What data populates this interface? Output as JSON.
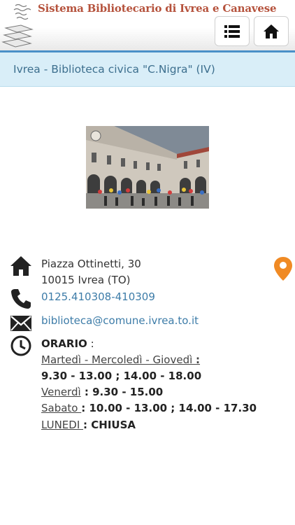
{
  "header": {
    "site_title": "Sistema Bibliotecario di Ivrea e Canavese",
    "menu_icon": "list-icon",
    "home_icon": "home-icon",
    "brand_color": "#b5523c",
    "accent_color": "#4a90c8"
  },
  "breadcrumb": {
    "title": "Ivrea - Biblioteca civica \"C.Nigra\" (IV)"
  },
  "library": {
    "address_line1": "Piazza Ottinetti, 30",
    "address_line2": "10015 Ivrea (TO)",
    "phone": "0125.410308-410309",
    "email": "biblioteca@comune.ivrea.to.it",
    "hours_label": "ORARIO",
    "hours_colon": " :",
    "schedule": [
      {
        "day": "Martedì - Mercoledì - Giovedì ",
        "sep": ":",
        "time": ""
      },
      {
        "day": "",
        "sep": "",
        "time": "9.30 - 13.00 ; 14.00 - 18.00"
      },
      {
        "day": "Venerdì",
        "sep": " : ",
        "time": "9.30 - 15.00"
      },
      {
        "day": "Sabato ",
        "sep": ": ",
        "time": "10.00 - 13.00 ; 14.00 - 17.30"
      },
      {
        "day": "LUNEDI ",
        "sep": ": ",
        "time": "CHIUSA"
      }
    ],
    "icons": [
      "home-icon",
      "phone-icon",
      "envelope-icon",
      "clock-icon",
      "map-marker-icon"
    ],
    "marker_color": "#f08a24"
  }
}
